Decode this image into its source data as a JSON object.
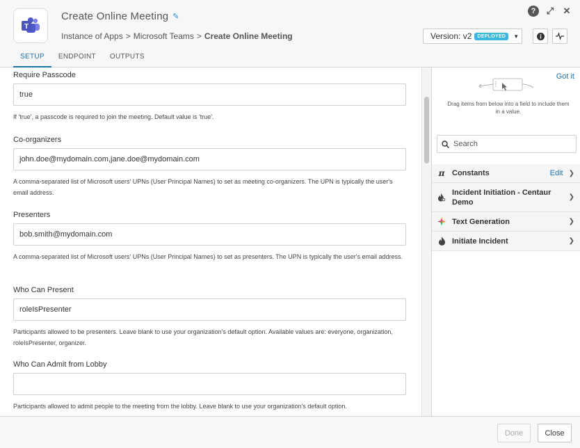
{
  "header": {
    "title": "Create Online Meeting",
    "breadcrumb": {
      "items": [
        "Instance of Apps",
        "Microsoft Teams"
      ],
      "separator": ">",
      "current": "Create Online Meeting"
    },
    "version": {
      "label": "Version: v2",
      "badge": "DEPLOYED"
    },
    "icons": {
      "help": "?",
      "expand": "⤢",
      "close": "✕",
      "info": "i"
    }
  },
  "tabs": [
    {
      "label": "SETUP",
      "active": true
    },
    {
      "label": "ENDPOINT",
      "active": false
    },
    {
      "label": "OUTPUTS",
      "active": false
    }
  ],
  "fields": [
    {
      "label": "Require Passcode",
      "value": "true",
      "help": "If 'true', a passcode is required to join the meeting. Default value is 'true'."
    },
    {
      "label": "Co-organizers",
      "value": "john.doe@mydomain.com,jane.doe@mydomain.com",
      "help": "A comma-separated list of Microsoft users' UPNs (User Principal Names) to set as meeting co-organizers. The UPN is typically the user's email address."
    },
    {
      "label": "Presenters",
      "value": "bob.smith@mydomain.com",
      "help": "A comma-separated list of Microsoft users' UPNs (User Principal Names) to set as presenters. The UPN is typically the user's email address."
    },
    {
      "label": "Who Can Present",
      "value": "roleIsPresenter",
      "help": "Participants allowed to be presenters. Leave blank to use your organization's default option. Available values are: everyone, organization, roleIsPresenter, organizer."
    },
    {
      "label": "Who Can Admit from Lobby",
      "value": "",
      "help": "Participants allowed to admit people to the meeting from the lobby. Leave blank to use your organization's default option."
    }
  ],
  "panel": {
    "got_it": "Got it",
    "drag_hint": "Drag items from below into a field to include them in a value.",
    "search_placeholder": "Search",
    "items": [
      {
        "label": "Constants",
        "icon": "pi-icon",
        "edit": "Edit"
      },
      {
        "label": "Incident Initiation - Centaur Demo",
        "icon": "flame-gear-icon"
      },
      {
        "label": "Text Generation",
        "icon": "sparkle-icon"
      },
      {
        "label": "Initiate Incident",
        "icon": "flame-icon"
      }
    ]
  },
  "footer": {
    "done_label": "Done",
    "close_label": "Close"
  },
  "colors": {
    "accent": "#1c73b3",
    "badge": "#3bb6e0",
    "teams_purple": "#5059c9"
  }
}
